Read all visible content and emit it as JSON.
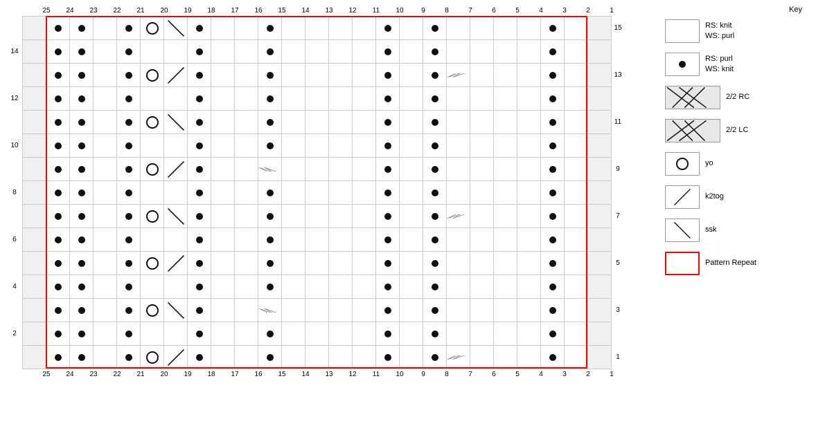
{
  "key": {
    "title": "Key",
    "items": [
      {
        "id": "rs-knit",
        "label": "RS: knit\nWS: purl",
        "symbol": "blank"
      },
      {
        "id": "rs-purl",
        "label": "RS: purl\nWS: knit",
        "symbol": "dot"
      },
      {
        "id": "2-2-rc",
        "label": "2/2 RC",
        "symbol": "2-2-rc"
      },
      {
        "id": "2-2-lc",
        "label": "2/2 LC",
        "symbol": "2-2-lc"
      },
      {
        "id": "yo",
        "label": "yo",
        "symbol": "yo"
      },
      {
        "id": "k2tog",
        "label": "k2tog",
        "symbol": "k2tog"
      },
      {
        "id": "ssk",
        "label": "ssk",
        "symbol": "ssk"
      },
      {
        "id": "pattern-repeat",
        "label": "Pattern Repeat",
        "symbol": "pattern-repeat"
      }
    ]
  },
  "chart": {
    "cols": [
      25,
      24,
      23,
      22,
      21,
      20,
      19,
      18,
      17,
      16,
      15,
      14,
      13,
      12,
      11,
      10,
      9,
      8,
      7,
      6,
      5,
      4,
      3,
      2,
      1
    ],
    "rows": [
      15,
      14,
      13,
      12,
      11,
      10,
      9,
      8,
      7,
      6,
      5,
      4,
      3,
      2,
      1
    ]
  }
}
